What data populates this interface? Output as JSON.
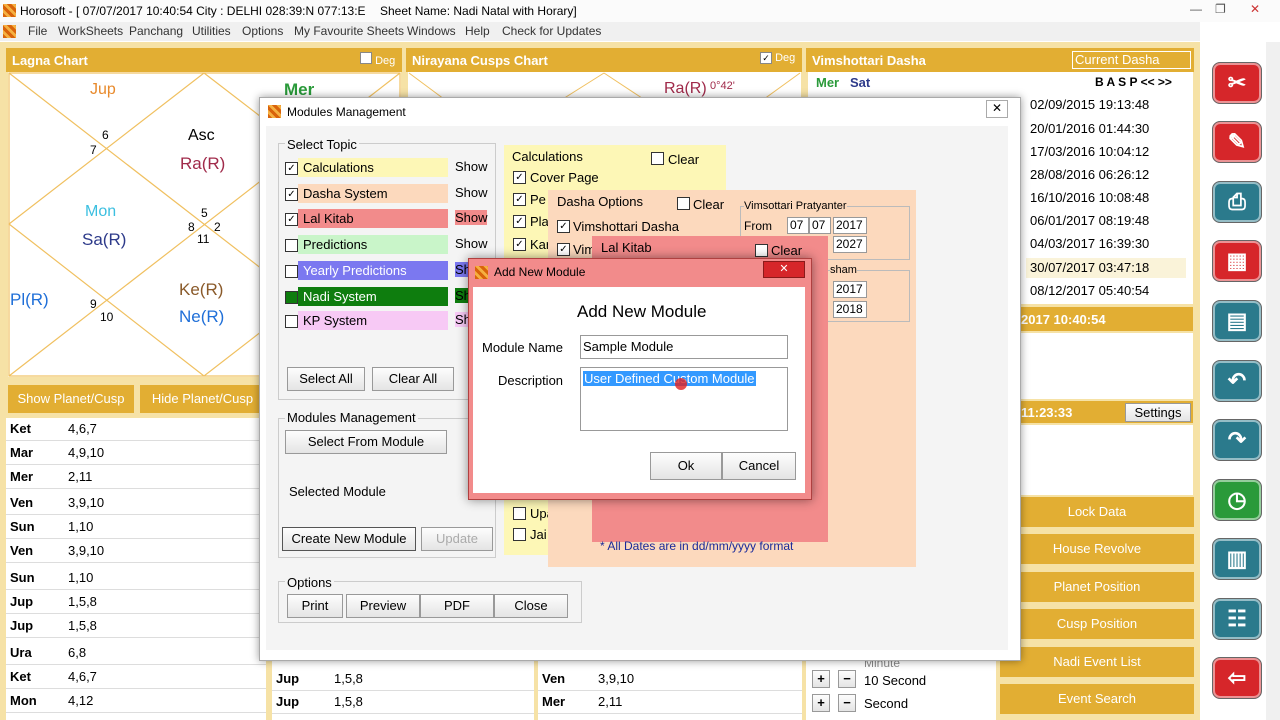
{
  "titlebar": {
    "title": "Horosoft - [ 07/07/2017 10:40:54  City : DELHI 028:39:N 077:13:E",
    "sheet": "Sheet Name: Nadi Natal with Horary]"
  },
  "menu": [
    "File",
    "WorkSheets",
    "Panchang",
    "Utilities",
    "Options",
    "My Favourite Sheets",
    "Windows",
    "Help",
    "Check for Updates"
  ],
  "lagna": {
    "title": "Lagna Chart",
    "deg": "Deg",
    "planets": {
      "jup": "Jup",
      "mer": "Mer",
      "asc": "Asc",
      "ra": "Ra(R)",
      "mon": "Mon",
      "sa": "Sa(R)",
      "pl": "Pl(R)",
      "ke": "Ke(R)",
      "ne": "Ne(R)"
    },
    "houses": {
      "h6": "6",
      "h7": "7",
      "h5": "5",
      "h8": "8",
      "h2": "2",
      "h11": "11",
      "h9": "9",
      "h10": "10"
    }
  },
  "cusps": {
    "title": "Nirayana Cusps Chart",
    "deg": "Deg",
    "ra": "Ra(R)",
    "ra_deg": "0°42'"
  },
  "dasha": {
    "title": "Vimshottari Dasha",
    "current": "Current Dasha",
    "mer": "Mer",
    "sat": "Sat",
    "nav": "B  A  S  P  <<  >>",
    "dates": [
      "02/09/2015 19:13:48",
      "20/01/2016 01:44:30",
      "17/03/2016 10:04:12",
      "28/08/2016 06:26:12",
      "16/10/2016 10:08:48",
      "06/01/2017 08:19:48",
      "04/03/2017 16:39:30",
      "30/07/2017 03:47:18",
      "08/12/2017 05:40:54"
    ],
    "now": "2017 10:40:54",
    "time": "11:23:33",
    "settings": "Settings"
  },
  "buttons": {
    "show_cusp": "Show Planet/Cusp",
    "hide_cusp": "Hide Planet/Cusp"
  },
  "table_left": [
    {
      "p": "Ket",
      "v": "4,6,7"
    },
    {
      "p": "Mar",
      "v": "4,9,10"
    },
    {
      "p": "Mer",
      "v": "2,11"
    },
    {
      "p": "Ven",
      "v": "3,9,10"
    },
    {
      "p": "Sun",
      "v": "1,10"
    },
    {
      "p": "Ven",
      "v": "3,9,10"
    },
    {
      "p": "Sun",
      "v": "1,10"
    },
    {
      "p": "Jup",
      "v": "1,5,8"
    },
    {
      "p": "Jup",
      "v": "1,5,8"
    },
    {
      "p": "Ura",
      "v": "6,8"
    },
    {
      "p": "Ket",
      "v": "4,6,7"
    },
    {
      "p": "Mon",
      "v": "4,12"
    }
  ],
  "table_mid": [
    {
      "p": "Jup",
      "v": "1,5,8"
    },
    {
      "p": "Jup",
      "v": "1,5,8"
    }
  ],
  "table_mid2": [
    {
      "p": "Ven",
      "v": "3,9,10"
    },
    {
      "p": "Mer",
      "v": "2,11"
    }
  ],
  "speed": {
    "minute": "Minute",
    "ten": "10 Second",
    "sec": "Second",
    "plus": "+",
    "minus": "−"
  },
  "side_buttons": [
    "Lock Data",
    "House Revolve",
    "Planet Position",
    "Cusp Position",
    "Nadi Event List",
    "Event Search"
  ],
  "modules": {
    "title": "Modules Management",
    "select_topic": "Select Topic",
    "topics": [
      {
        "label": "Calculations",
        "show": "Show",
        "checked": true,
        "color": "#fdf7b6"
      },
      {
        "label": "Dasha System",
        "show": "Show",
        "checked": true,
        "color": "#fcd9bd"
      },
      {
        "label": "Lal Kitab",
        "show": "Show",
        "checked": true,
        "color": "#f28b8b"
      },
      {
        "label": "Predictions",
        "show": "Show",
        "checked": false,
        "color": "#c9f5c9"
      },
      {
        "label": "Yearly Predictions",
        "show": "Sh",
        "checked": false,
        "color": "#7b78f0"
      },
      {
        "label": "Nadi System",
        "show": "Sh",
        "checked": false,
        "color": "#0e7d0e"
      },
      {
        "label": "KP System",
        "show": "Sh",
        "checked": false,
        "color": "#f7c9f5"
      }
    ],
    "select_all": "Select All",
    "clear_all": "Clear All",
    "mm_group": "Modules Management",
    "select_from": "Select From Module",
    "selected_module": "Selected Module",
    "create_new": "Create New Module",
    "update": "Update",
    "options": "Options",
    "print": "Print",
    "preview": "Preview",
    "pdf": "PDF",
    "close": "Close"
  },
  "calc": {
    "title": "Calculations",
    "clear": "Clear",
    "cover": "Cover Page",
    "pe": "Pe",
    "pla": "Pla",
    "kar": "Kar",
    "upa": "Upa",
    "jai": "Jai"
  },
  "dasha_opt": {
    "title": "Dasha Options",
    "clear": "Clear",
    "vim": "Vimshottari Dasha",
    "vim2": "Vim",
    "pratyanter": "Vimsottari Pratyanter",
    "from": "From",
    "d": "07",
    "m": "07",
    "y": "2017",
    "y2": "2027",
    "sham": "sham",
    "y3": "2017",
    "y4": "2018",
    "note": "* All Dates are in dd/mm/yyyy format"
  },
  "lalkitab": {
    "title": "Lal Kitab",
    "clear": "Clear"
  },
  "addmodule": {
    "title": "Add New Module",
    "heading": "Add New Module",
    "name_label": "Module Name",
    "name_value": "Sample Module",
    "desc_label": "Description",
    "desc_value": "User Defined Custom Module",
    "ok": "Ok",
    "cancel": "Cancel",
    "close": "✕"
  },
  "colors": {
    "gold": "#e2ae33",
    "red_btn": "#d6262a",
    "teal_btn": "#2b7a8c"
  }
}
